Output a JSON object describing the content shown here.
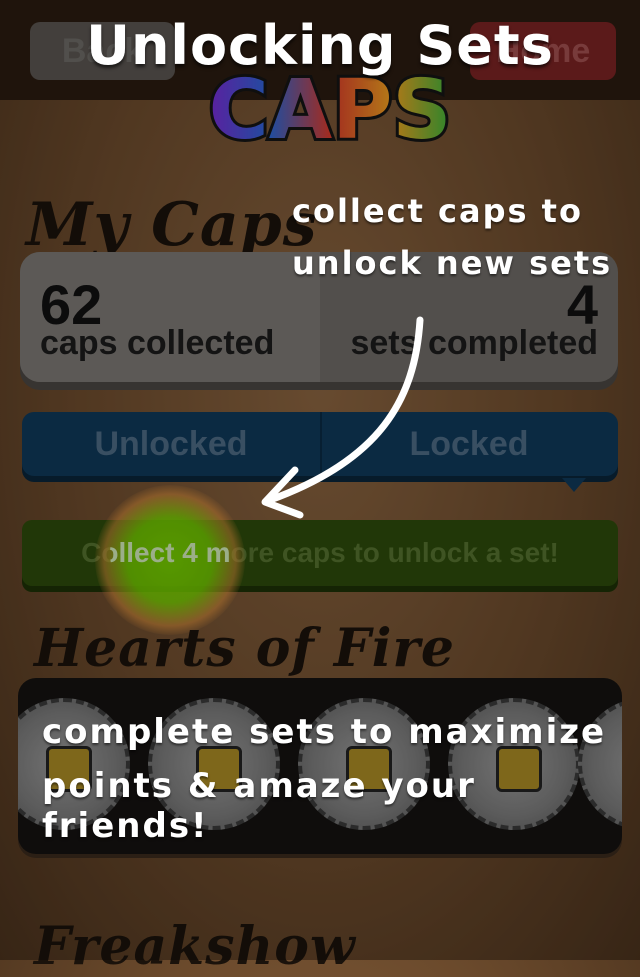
{
  "nav": {
    "back_label": "Back",
    "home_label": "Home"
  },
  "logo": {
    "text": "CAPS"
  },
  "overlay": {
    "title": "Unlocking Sets",
    "hint_top_line1": "collect caps to",
    "hint_top_line2": "unlock new sets",
    "hint_bottom_line1": "complete sets to maximize",
    "hint_bottom_line2": "points & amaze your friends!"
  },
  "my_caps": {
    "title": "My Caps",
    "caps_collected_value": "62",
    "caps_collected_label": "caps collected",
    "sets_completed_value": "4",
    "sets_completed_label": "sets completed"
  },
  "tabs": {
    "unlocked_label": "Unlocked",
    "locked_label": "Locked"
  },
  "progress": {
    "message": "Collect 4 more caps to unlock a set!"
  },
  "sets": [
    {
      "title": "Hearts of Fire"
    },
    {
      "title": "Freakshow"
    }
  ],
  "colors": {
    "background_brown": "#6b4a2c",
    "tab_blue": "#0f3858",
    "banner_green": "#2c4a0b",
    "highlight_green": "#78d200",
    "back_button": "#5a5550",
    "home_button": "#7a2323"
  }
}
